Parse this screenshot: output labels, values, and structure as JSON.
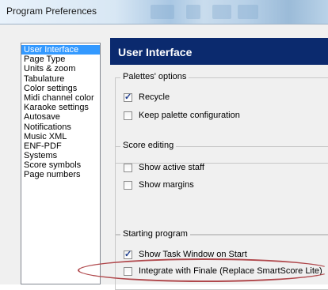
{
  "window": {
    "title": "Program Preferences"
  },
  "nav": {
    "items": [
      "User Interface",
      "Page Type",
      "Units & zoom",
      "Tabulature",
      "Color settings",
      "Midi channel color",
      "Karaoke settings",
      "Autosave",
      "Notifications",
      "Music XML",
      "ENF-PDF",
      "Systems",
      "Score symbols",
      "Page numbers"
    ],
    "selected": "User Interface"
  },
  "panel": {
    "title": "User Interface",
    "palettes": {
      "legend": "Palettes' options",
      "recycle": {
        "label": "Recycle",
        "checked": true
      },
      "keep": {
        "label": "Keep palette configuration",
        "checked": false
      }
    },
    "score_editing": {
      "legend": "Score editing",
      "active_staff": {
        "label": "Show active staff",
        "checked": false
      },
      "margins": {
        "label": "Show margins",
        "checked": false
      }
    },
    "starting_program": {
      "legend": "Starting program",
      "task_window": {
        "label": "Show Task Window on Start",
        "checked": true
      },
      "integrate": {
        "label": "Integrate with Finale (Replace SmartScore Lite)",
        "checked": false
      }
    }
  },
  "annotation": {
    "color": "#b0484c"
  }
}
